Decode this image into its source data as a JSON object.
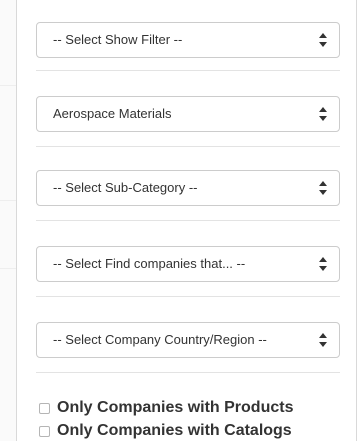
{
  "filters": [
    {
      "label": "-- Select Show Filter --"
    },
    {
      "label": "Aerospace Materials"
    },
    {
      "label": "-- Select Sub-Category --"
    },
    {
      "label": "-- Select Find companies that... --"
    },
    {
      "label": "-- Select Company Country/Region --"
    }
  ],
  "checkboxes": [
    {
      "label": "Only Companies with Products",
      "checked": false
    },
    {
      "label": "Only Companies with Catalogs",
      "checked": false
    }
  ],
  "icons": {
    "select_arrow": "up-down-chevron-icon"
  },
  "colors": {
    "border": "#cccccc",
    "text": "#333333",
    "divider": "#e3e3e3"
  }
}
